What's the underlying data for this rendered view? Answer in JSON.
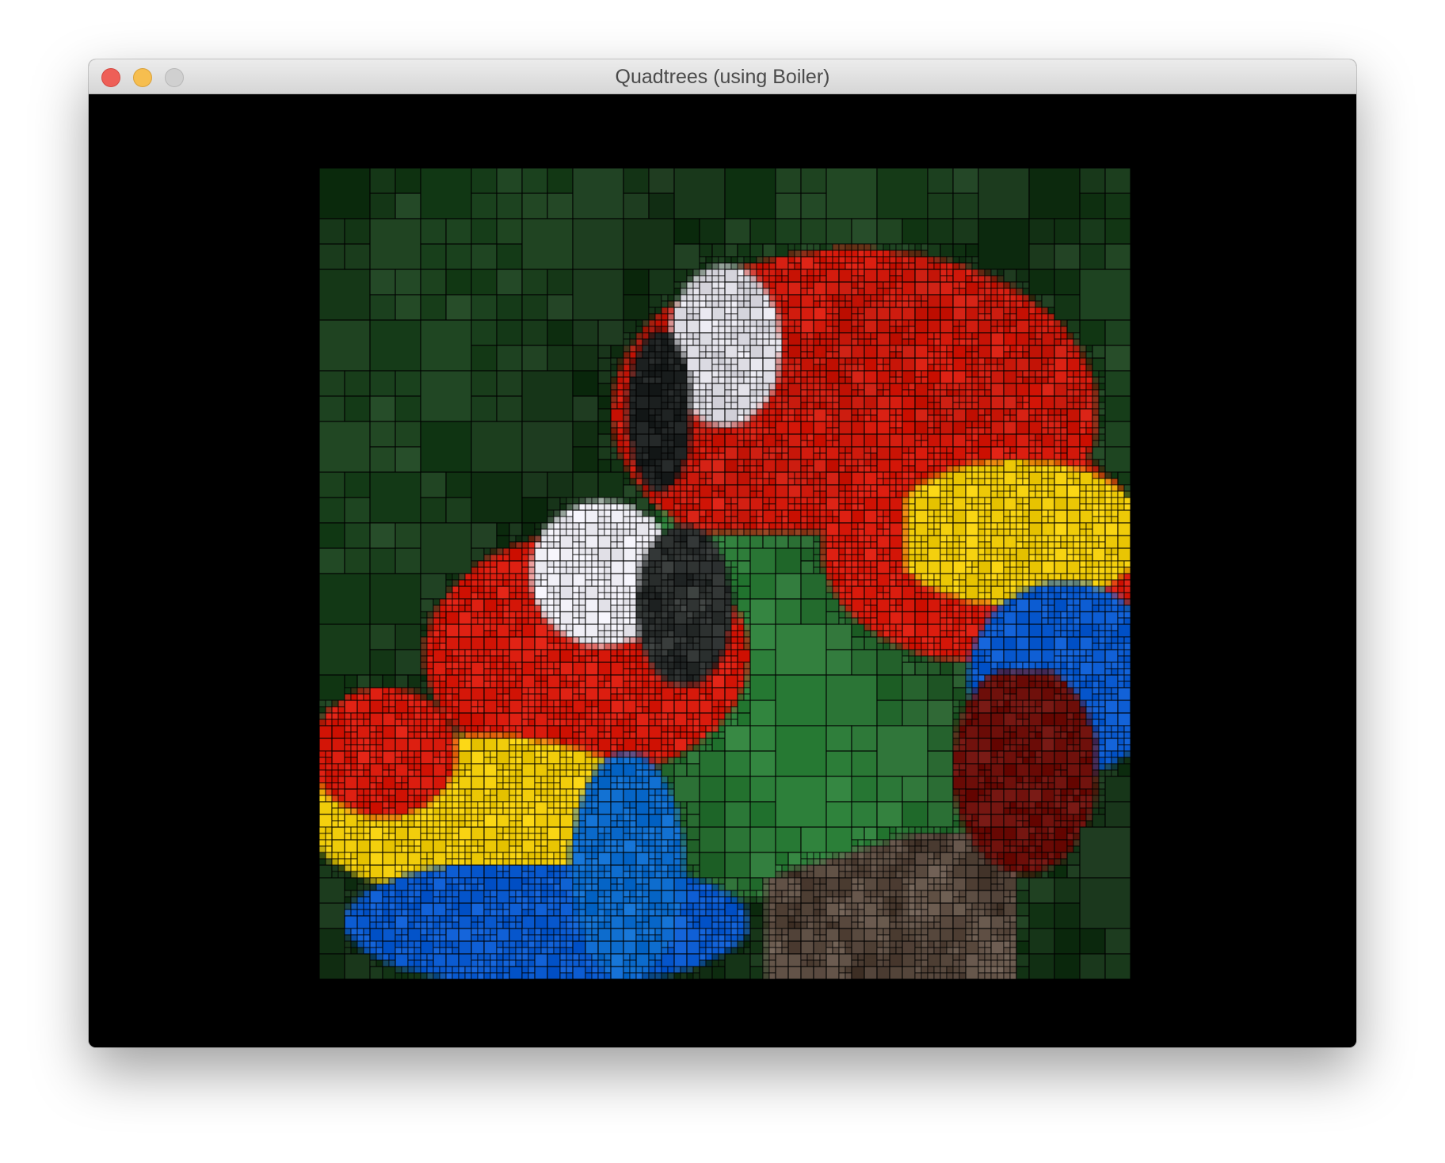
{
  "window": {
    "title": "Quadtrees (using Boiler)"
  },
  "content": {
    "background_color": "#000000",
    "image_description_icon": "quadtree-parrot-image",
    "palette": {
      "foliage_dark": "#0f2410",
      "foliage_mid": "#1f4a22",
      "foliage_light": "#2f8a3e",
      "red_plumage": "#d81a0c",
      "yellow_plumage": "#f0cc0a",
      "blue_plumage": "#0a5ad0",
      "white_face": "#ecebf2",
      "beak_dark": "#1e2222",
      "branch": "#6e5e52"
    }
  }
}
